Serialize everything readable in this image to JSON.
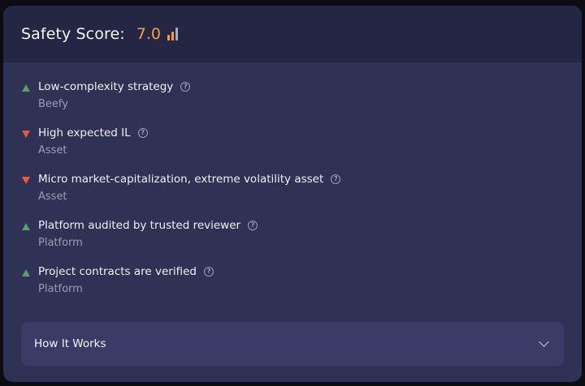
{
  "header": {
    "title": "Safety Score:",
    "score": "7.0",
    "score_color": "#f49e46",
    "bars_icon": "signal-bars-icon",
    "bars_filled": 2,
    "bars_total": 3
  },
  "factors": [
    {
      "direction": "up",
      "title": "Low-complexity strategy",
      "category": "Beefy"
    },
    {
      "direction": "down",
      "title": "High expected IL",
      "category": "Asset"
    },
    {
      "direction": "down",
      "title": "Micro market-capitalization, extreme volatility asset",
      "category": "Asset"
    },
    {
      "direction": "up",
      "title": "Platform audited by trusted reviewer",
      "category": "Platform"
    },
    {
      "direction": "up",
      "title": "Project contracts are verified",
      "category": "Platform"
    }
  ],
  "how_it_works": {
    "label": "How It Works",
    "icon": "chevron-down-icon"
  },
  "colors": {
    "positive": "#5d9a6f",
    "negative": "#e35d3c"
  }
}
